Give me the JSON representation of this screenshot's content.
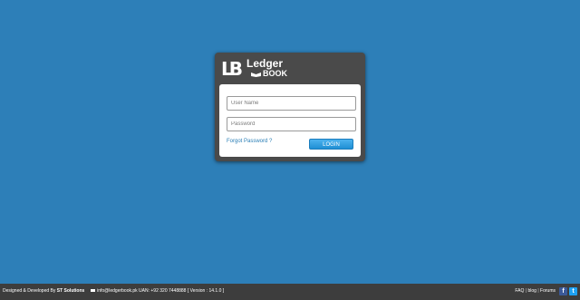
{
  "logo": {
    "lb": "LB",
    "ledger": "Ledger",
    "book": "BOOK"
  },
  "form": {
    "username_placeholder": "User Name",
    "password_placeholder": "Password",
    "forgot_label": "Forgot Password ?",
    "login_label": "LOGIN"
  },
  "footer": {
    "designed_prefix": "Designed & Developed By",
    "company": "ST Solutions",
    "contact": "info@ledgerbook.pk UAN: +92 320 7448888 [ Version : 14.1.0 ]",
    "links": [
      "FAQ",
      "blog",
      "Forums"
    ]
  },
  "colors": {
    "background": "#2d7fb8",
    "panel": "#4a4a4a",
    "accent": "#1f8fd4"
  },
  "icons": {
    "mail": "mail-icon",
    "facebook": "facebook-icon",
    "twitter": "twitter-icon"
  }
}
